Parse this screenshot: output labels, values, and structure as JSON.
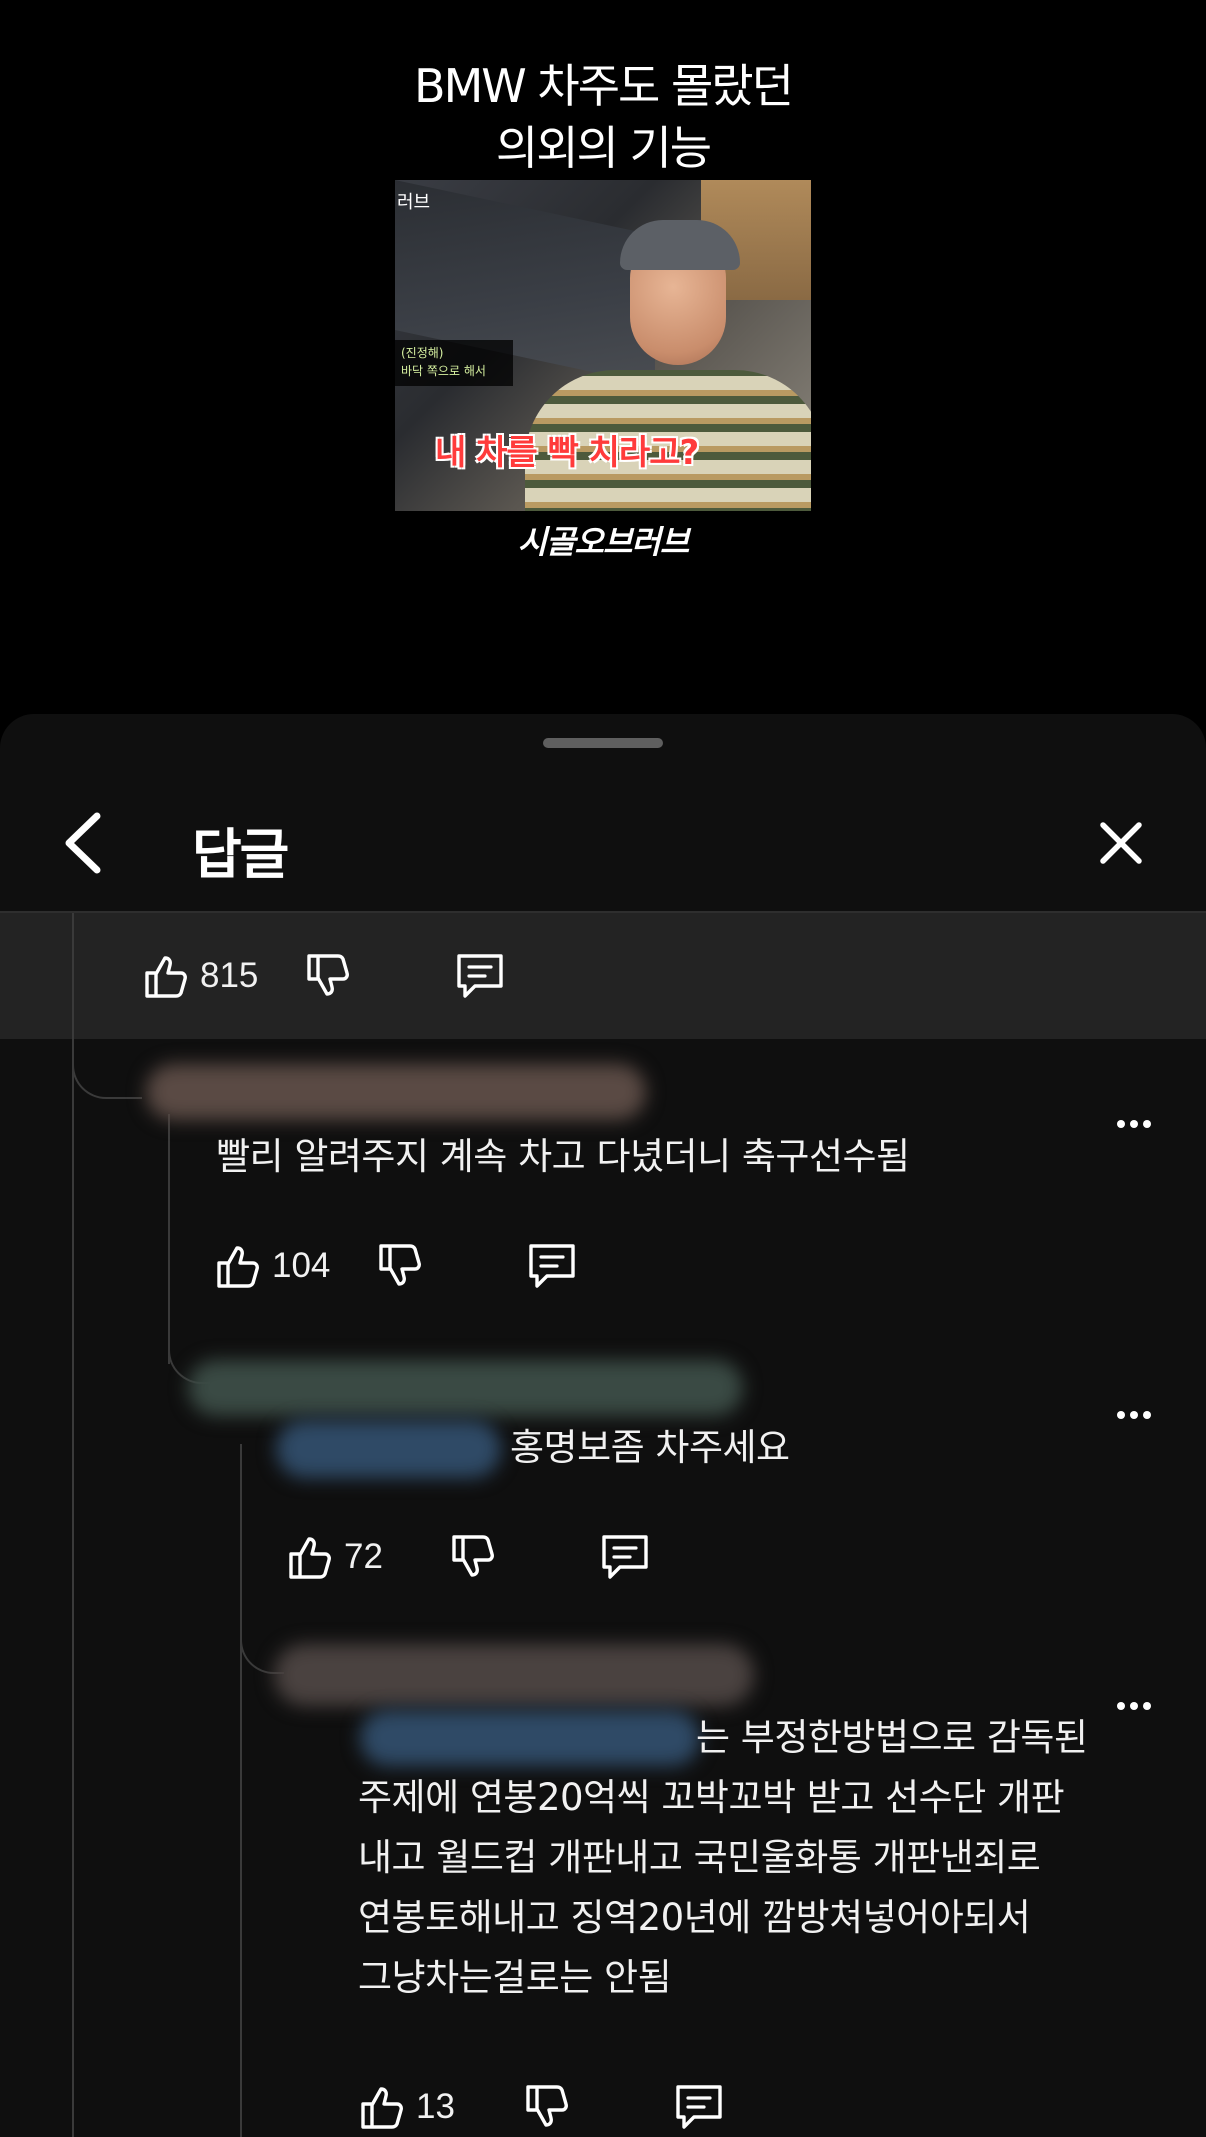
{
  "video": {
    "title_line1": "BMW 차주도 몰랐던",
    "title_line2": "의외의 기능",
    "thumb_logo": "러브",
    "thumb_caption_line1": "(진정해)",
    "thumb_caption_line2": "바닥 쪽으로 해서",
    "thumb_subtitle": "내 차를 빡 치라고?",
    "channel_mark": "시골오브러브"
  },
  "sheet": {
    "title": "답글",
    "back_icon": "chevron-left-icon",
    "close_icon": "close-icon"
  },
  "parent": {
    "likes": "815"
  },
  "replies": [
    {
      "text": "빨리 알려주지 계속 차고 다녔더니 축구선수됨",
      "likes": "104"
    },
    {
      "text": "홍명보좀 차주세요",
      "likes": "72"
    },
    {
      "text_lines": [
        "는 부정한방법으로 감독된",
        "주제에 연봉20억씩 꼬박꼬박 받고 선수단 개판",
        "내고 월드컵 개판내고 국민울화통 개판낸죄로",
        "연봉토해내고 징역20년에 깜방쳐넣어아되서",
        "그냥차는걸로는 안됨"
      ],
      "likes": "13"
    }
  ],
  "colors": {
    "background": "#0f0f0f",
    "parent_bar": "#232323",
    "text": "#f1f1f1"
  }
}
